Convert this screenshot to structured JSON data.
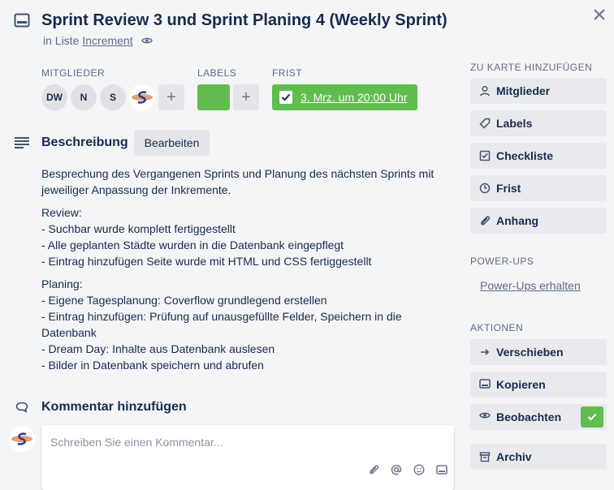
{
  "header": {
    "title": "Sprint Review 3 und Sprint Planing 4 (Weekly Sprint)",
    "in_list_prefix": "in Liste",
    "list_name": "Increment"
  },
  "members": {
    "label": "MITGLIEDER",
    "avatars": [
      "DW",
      "N",
      "S"
    ]
  },
  "labels": {
    "label": "LABELS",
    "color": "#61bd4f"
  },
  "due": {
    "label": "FRIST",
    "date": "3. Mrz. um 20:00 Uhr",
    "color": "#61bd4f"
  },
  "description": {
    "title": "Beschreibung",
    "edit_label": "Bearbeiten",
    "intro": "Besprechung des Vergangenen Sprints und Planung des nächsten Sprints mit jeweiliger Anpassung der Inkremente.",
    "review_lines": [
      "Review:",
      "- Suchbar wurde komplett fertiggestellt",
      "- Alle geplanten Städte wurden in die Datenbank eingepflegt",
      "- Eintrag hinzufügen Seite wurde mit HTML und CSS fertiggestellt"
    ],
    "planing_lines": [
      "Planing:",
      "- Eigene Tagesplanung: Coverflow grundlegend erstellen",
      "- Eintrag hinzufügen: Prüfung auf unausgefüllte Felder, Speichern in die Datenbank",
      "- Dream Day: Inhalte aus Datenbank auslesen",
      "- Bilder in Datenbank speichern und abrufen"
    ]
  },
  "comment": {
    "title": "Kommentar hinzufügen",
    "placeholder": "Schreiben Sie einen Kommentar..."
  },
  "sidebar": {
    "add_label": "ZU KARTE HINZUFÜGEN",
    "add_buttons": [
      "Mitglieder",
      "Labels",
      "Checkliste",
      "Frist",
      "Anhang"
    ],
    "powerups_label": "POWER-UPS",
    "powerups_link": "Power-Ups erhalten",
    "actions_label": "AKTIONEN",
    "action_buttons": [
      "Verschieben",
      "Kopieren",
      "Beobachten",
      "Archiv"
    ],
    "watch_active_color": "#61bd4f"
  }
}
